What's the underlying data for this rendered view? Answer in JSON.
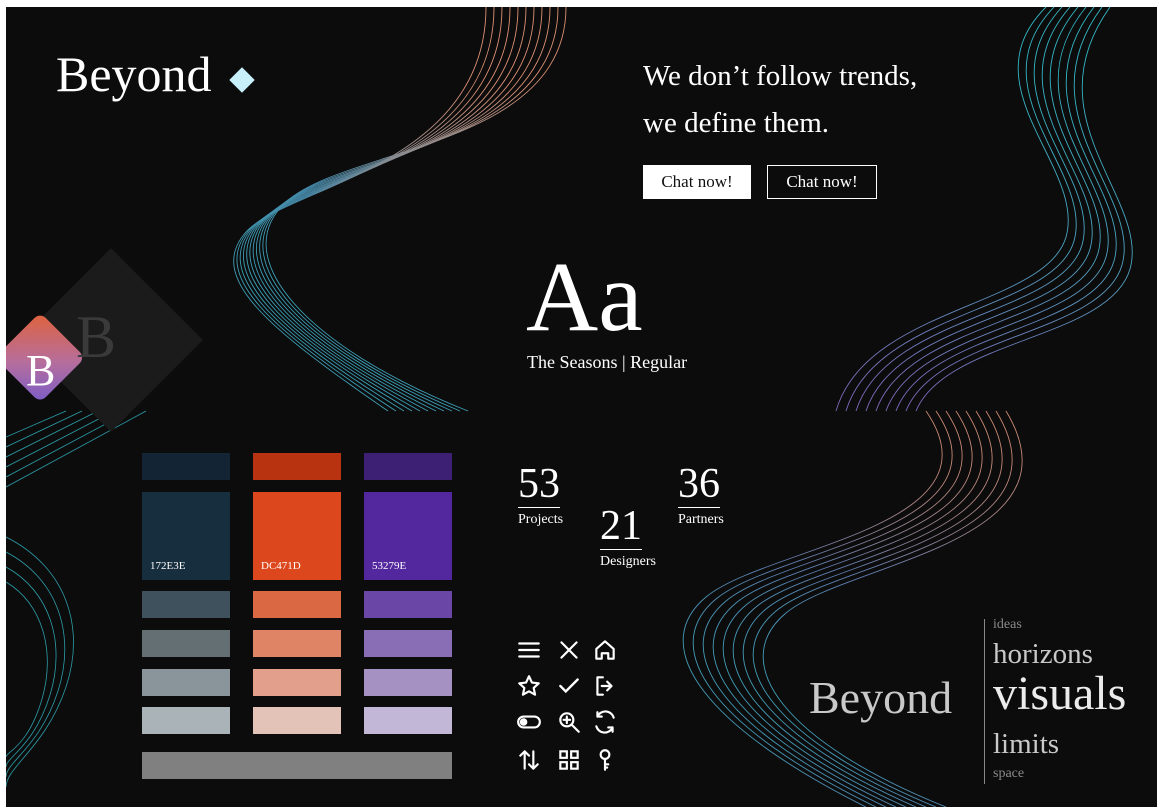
{
  "brand": {
    "logo_text": "Beyond",
    "diamond_color": "#c7f0fb"
  },
  "tagline": {
    "line1": "We don’t follow trends,",
    "line2": "we define them."
  },
  "buttons": {
    "primary": "Chat now!",
    "secondary": "Chat now!"
  },
  "badge": {
    "letter": "B",
    "ghost_letter": "B"
  },
  "typography": {
    "sample": "Aa",
    "font_name": "The Seasons",
    "separator": "|",
    "weight": "Regular"
  },
  "palette": {
    "columns": [
      {
        "code": "172E3E",
        "base": "#172e3e",
        "top": "#132534",
        "tints": [
          "#3e515c",
          "#646f74",
          "#8a949b",
          "#aab3b7"
        ]
      },
      {
        "code": "DC471D",
        "base": "#dc471d",
        "top": "#b8330f",
        "tints": [
          "#d96843",
          "#df8464",
          "#e2a08c",
          "#e3c3b8"
        ]
      },
      {
        "code": "53279E",
        "base": "#53279e",
        "top": "#3d1f74",
        "tints": [
          "#6a47a6",
          "#8a6eb5",
          "#a592c2",
          "#c2b7d6"
        ]
      }
    ],
    "neutral": "#808080"
  },
  "stats": [
    {
      "value": "53",
      "label": "Projects"
    },
    {
      "value": "21",
      "label": "Designers"
    },
    {
      "value": "36",
      "label": "Partners"
    }
  ],
  "icons": [
    "menu-icon",
    "close-icon",
    "home-icon",
    "star-icon",
    "check-icon",
    "logout-icon",
    "toggle-icon",
    "zoom-in-icon",
    "refresh-icon",
    "sort-icon",
    "grid-icon",
    "key-icon"
  ],
  "wordmark": {
    "brand": "Beyond",
    "words": [
      "ideas",
      "horizons",
      "visuals",
      "limits",
      "space"
    ]
  },
  "ribbon_colors": {
    "cyan": "#35c2cf",
    "peach": "#e89878",
    "violet": "#8a6cc4"
  }
}
